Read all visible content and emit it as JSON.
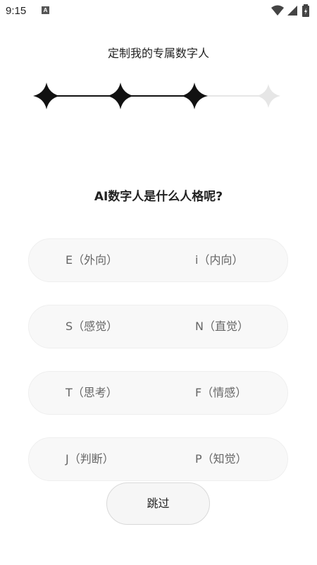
{
  "status_bar": {
    "time": "9:15",
    "icons": [
      "notification-a-icon",
      "wifi-icon",
      "signal-icon",
      "battery-icon"
    ]
  },
  "header": {
    "title": "定制我的专属数字人"
  },
  "progress": {
    "total_steps": 4,
    "completed_steps": 3,
    "active_color": "#111111",
    "inactive_color": "#e6e6e6"
  },
  "question": {
    "text": "AI数字人是什么人格呢?"
  },
  "options": [
    {
      "left": "E（外向）",
      "right": "i（内向）"
    },
    {
      "left": "S（感觉）",
      "right": "N（直觉）"
    },
    {
      "left": "T（思考）",
      "right": "F（情感）"
    },
    {
      "left": "J（判断）",
      "right": "P（知觉）"
    }
  ],
  "skip_button": {
    "label": "跳过"
  }
}
